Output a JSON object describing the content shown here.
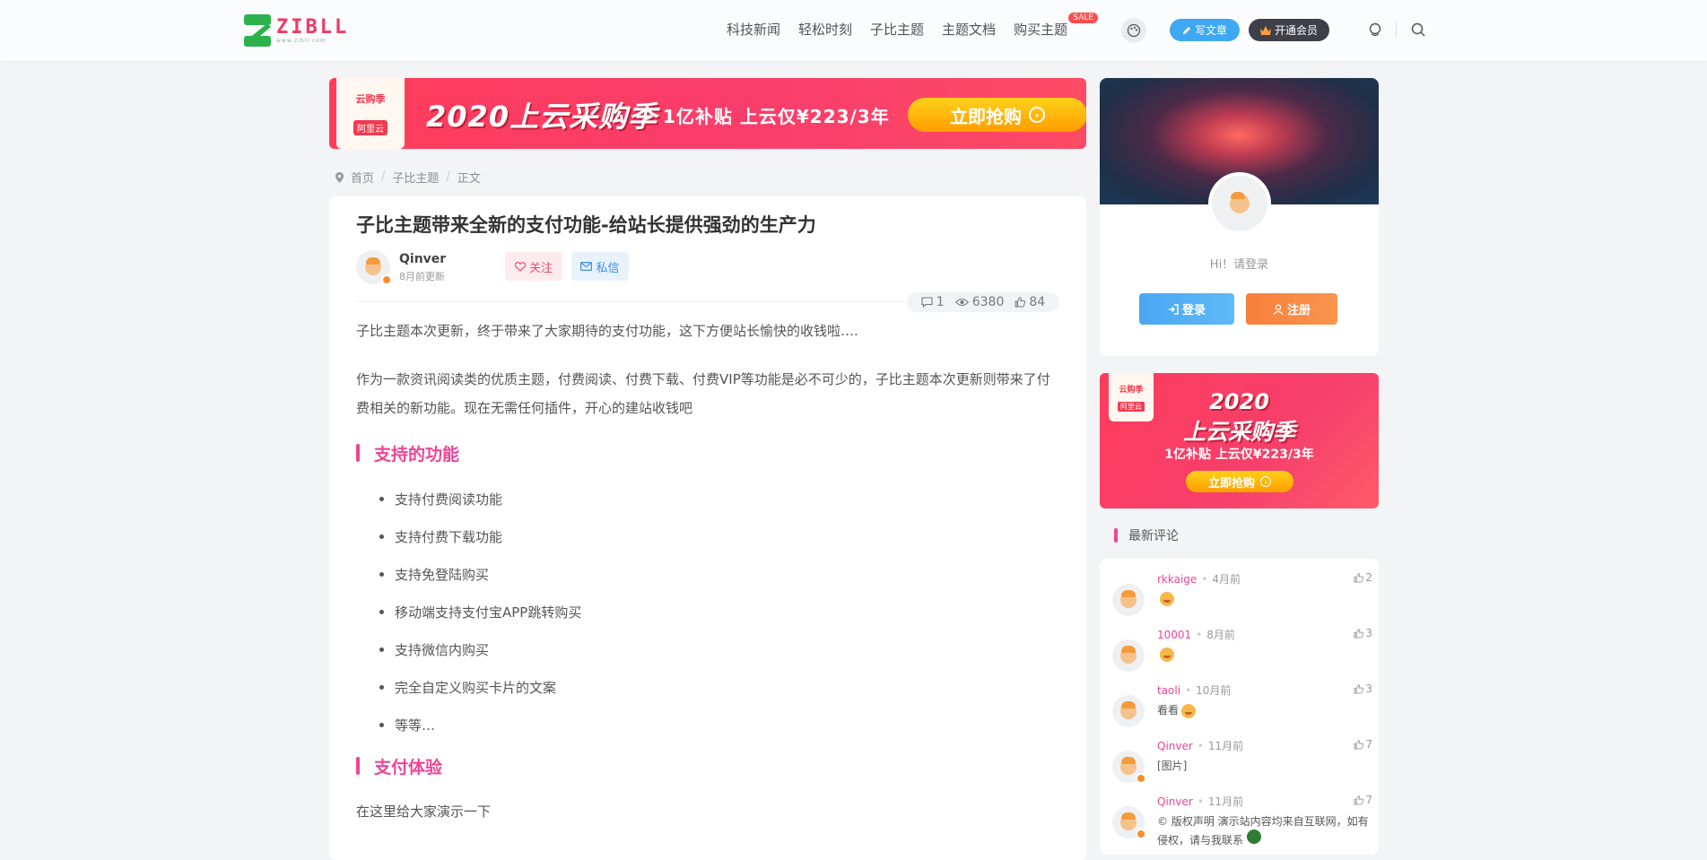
{
  "header": {
    "logo_text": "ZIBLL",
    "logo_sub": "www.zibll.com",
    "nav": [
      "科技新闻",
      "轻松时刻",
      "子比主题",
      "主题文档",
      "购买主题"
    ],
    "sale_badge": "SALE",
    "write_label": "写文章",
    "vip_label": "开通会员"
  },
  "banner": {
    "logo_line1": "云购季",
    "logo_line2": "阿里云",
    "title": "2020上云采购季",
    "subtitle": "1亿补贴  上云仅¥223/3年",
    "cta": "立即抢购"
  },
  "breadcrumb": [
    "首页",
    "子比主题",
    "正文"
  ],
  "article": {
    "title": "子比主题带来全新的支付功能-给站长提供强劲的生产力",
    "author_name": "Qinver",
    "author_time": "8月前更新",
    "follow_label": "关注",
    "message_label": "私信",
    "comments_count": "1",
    "views_count": "6380",
    "likes_count": "84",
    "intro": "子比主题本次更新，终于带来了大家期待的支付功能，这下方便站长愉快的收钱啦….",
    "para2": "作为一款资讯阅读类的优质主题，付费阅读、付费下载、付费VIP等功能是必不可少的，子比主题本次更新则带来了付费相关的新功能。现在无需任何插件，开心的建站收钱吧",
    "heading1": "支持的功能",
    "features": [
      "支持付费阅读功能",
      "支持付费下载功能",
      "支持免登陆购买",
      "移动端支持支付宝APP跳转购买",
      "支持微信内购买",
      "完全自定义购买卡片的文案",
      "等等…"
    ],
    "heading2": "支付体验",
    "para3": "在这里给大家演示一下"
  },
  "sidebar": {
    "hi_text": "Hi！请登录",
    "login_label": "登录",
    "register_label": "注册",
    "banner_logo_line1": "云购季",
    "banner_logo_line2": "阿里云",
    "banner_year": "2020",
    "banner_title": "上云采购季",
    "banner_sub": "1亿补贴 上云仅¥223/3年",
    "banner_cta": "立即抢购",
    "comments_title": "最新评论",
    "comments": [
      {
        "name": "rkkaige",
        "time": "4月前",
        "likes": "2",
        "text": ""
      },
      {
        "name": "10001",
        "time": "8月前",
        "likes": "3",
        "text": ""
      },
      {
        "name": "taoli",
        "time": "10月前",
        "likes": "3",
        "text": "看看"
      },
      {
        "name": "Qinver",
        "time": "11月前",
        "likes": "7",
        "text": "[图片]"
      },
      {
        "name": "Qinver",
        "time": "11月前",
        "likes": "7",
        "text": "© 版权声明 演示站内容均来自互联网，如有侵权，请与我联系"
      }
    ]
  },
  "colors": {
    "accent_pink": "#f04494",
    "login_blue": "#4aa6f2",
    "register_orange": "#f6803c",
    "banner_red": "#ff3d5a"
  }
}
